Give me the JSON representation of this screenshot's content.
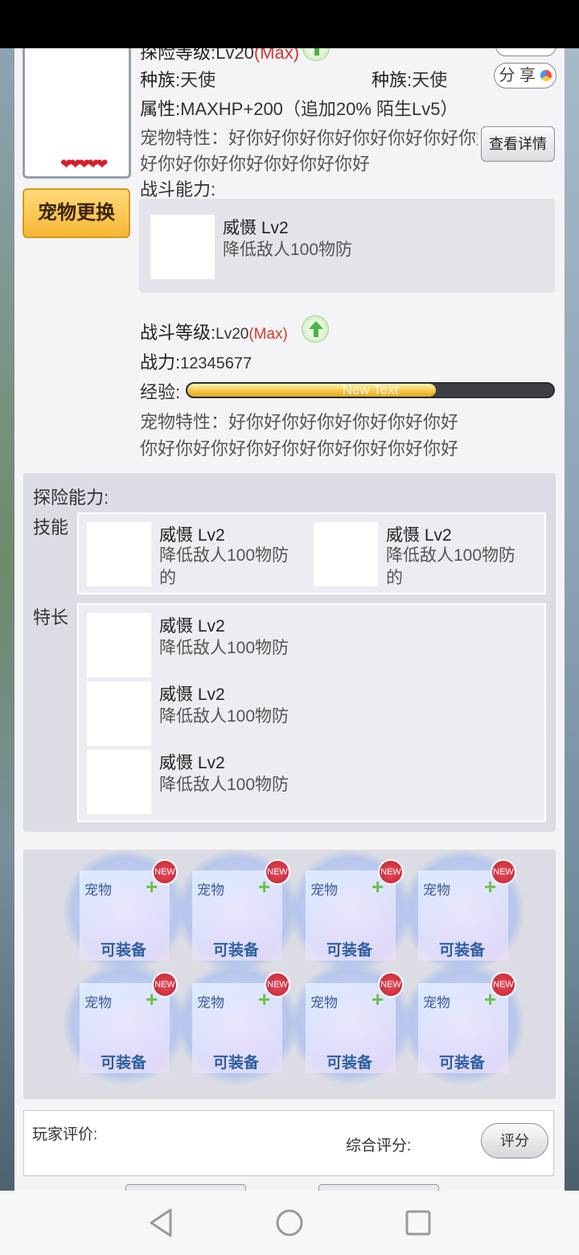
{
  "pet_header": {
    "level_label": "探险等级:",
    "level_value": "Lv20",
    "level_max": "(Max)",
    "race_label_1": "种族:",
    "race_value_1": "天使",
    "race_label_2": "种族:",
    "race_value_2": "天使",
    "share_label": "分 享",
    "attr_label": "属性:",
    "attr_value": "MAXHP+200（追加20% 陌生Lv5）",
    "trait_line1": "宠物特性：好你好你好你好你好你好你好你好",
    "trait_line2": "好你好你好你好你好你好你好",
    "detail_button": "查看详情",
    "hearts": "❤❤❤❤❤",
    "change_button": "宠物更换"
  },
  "battle": {
    "heading": "战斗能力:",
    "skill_name": "威慑 Lv2",
    "skill_desc": "降低敌人100物防",
    "level_label": "战斗等级:",
    "level_value": "Lv20",
    "level_max": "(Max)",
    "power_label": "战力:",
    "power_value": "12345677",
    "exp_label": "经验:",
    "exp_text": "New Text",
    "exp_fraction": 0.68,
    "trait_line1": "宠物特性：好你好你好你好你好你好你好",
    "trait_line2": "你好你好你好你好你好你好你好你好你好"
  },
  "adventure": {
    "heading": "探险能力:",
    "skills_label": "技能",
    "skills": [
      {
        "name": "威慑 Lv2",
        "desc": "降低敌人100物防的"
      },
      {
        "name": "威慑 Lv2",
        "desc": "降低敌人100物防的"
      }
    ],
    "specialty_label": "特长",
    "specialties": [
      {
        "name": "威慑 Lv2",
        "desc": "降低敌人100物防"
      },
      {
        "name": "威慑 Lv2",
        "desc": "降低敌人100物防"
      },
      {
        "name": "威慑 Lv2",
        "desc": "降低敌人100物防"
      }
    ]
  },
  "equip_slots": [
    {
      "top": "宠物",
      "bottom": "可装备",
      "badge": "NEW"
    },
    {
      "top": "宠物",
      "bottom": "可装备",
      "badge": "NEW"
    },
    {
      "top": "宠物",
      "bottom": "可装备",
      "badge": "NEW"
    },
    {
      "top": "宠物",
      "bottom": "可装备",
      "badge": "NEW"
    },
    {
      "top": "宠物",
      "bottom": "可装备",
      "badge": "NEW"
    },
    {
      "top": "宠物",
      "bottom": "可装备",
      "badge": "NEW"
    },
    {
      "top": "宠物",
      "bottom": "可装备",
      "badge": "NEW"
    },
    {
      "top": "宠物",
      "bottom": "可装备",
      "badge": "NEW"
    }
  ],
  "evaluation": {
    "player_label": "玩家评价:",
    "overall_label": "综合评分:",
    "rate_button": "评分"
  },
  "colors": {
    "accent_gold": "#f6b734",
    "max_red": "#d43a2a",
    "heart_red": "#d81e2c"
  }
}
